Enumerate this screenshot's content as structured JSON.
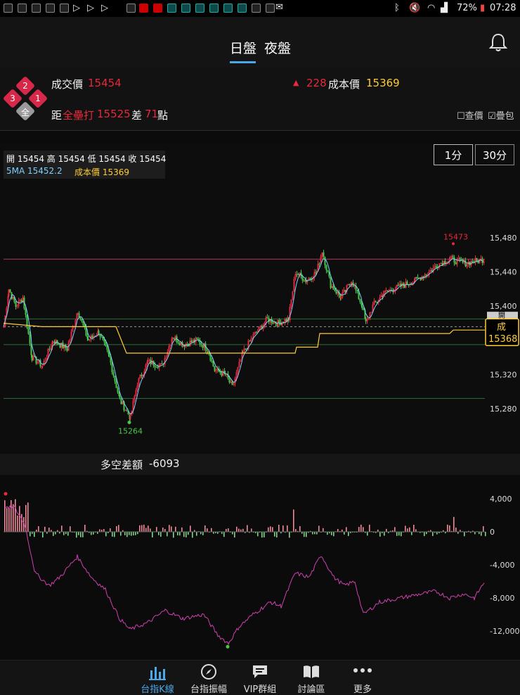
{
  "status_bar": {
    "battery": "72%",
    "time": "07:28"
  },
  "header": {
    "tabs": [
      {
        "label": "日盤"
      },
      {
        "label": "夜盤"
      }
    ]
  },
  "info": {
    "badges": [
      "2",
      "3",
      "1",
      "全"
    ],
    "price_label": "成交價",
    "price_value": "15454",
    "change_value": "228",
    "cost_label": "成本價",
    "cost_value": "15369",
    "dist_prefix": "距",
    "dist_name": "全壘打",
    "dist_value": "15525",
    "diff_label": "差",
    "diff_value": "71",
    "diff_unit": "點",
    "opt_query": "查價",
    "opt_stack": "疊包"
  },
  "ohlc": {
    "line1": "開 15454 高 15454 低 15454 收 15454",
    "ma_label": "5MA 15452.2",
    "cost_label": "成本價 15369"
  },
  "interval_buttons": [
    "1分",
    "30分"
  ],
  "price_chart": {
    "axis_ticks": [
      "15,480",
      "15,440",
      "15,400",
      "15,320",
      "15,280"
    ],
    "high_label": "15473",
    "low_label": "15264",
    "tag_top": "開",
    "tag_mid": "成",
    "tag_value": "15368"
  },
  "sub_chart": {
    "title": "多空差額",
    "value": "-6093",
    "axis_ticks": [
      "4,000",
      "0",
      "-4,000",
      "-8,000",
      "-12,000"
    ]
  },
  "nav": {
    "items": [
      {
        "label": "台指K線"
      },
      {
        "label": "台指振幅"
      },
      {
        "label": "VIP群組"
      },
      {
        "label": "討論區"
      },
      {
        "label": "更多"
      }
    ]
  },
  "colors": {
    "accent": "#4aa8e8",
    "up": "#e8283c",
    "down": "#46c846",
    "cost": "#ffcc33",
    "ma": "#7fd0ff",
    "diff_line": "#d040b0"
  }
}
